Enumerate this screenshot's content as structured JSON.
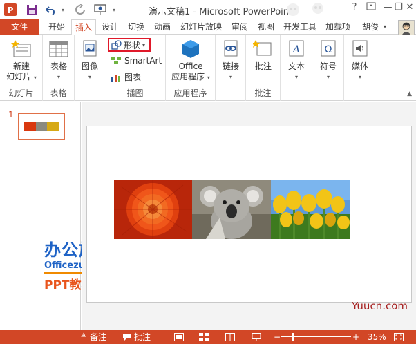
{
  "window": {
    "title": "演示文稿1 - Microsoft PowerPoint",
    "controls": {
      "help": "?",
      "minimize": "—",
      "restore": "❐",
      "close": "✕"
    }
  },
  "quick_access": [
    "save-icon",
    "undo-icon",
    "redo-icon",
    "slideshow-icon"
  ],
  "tabs": {
    "file": "文件",
    "items": [
      "开始",
      "插入",
      "设计",
      "切换",
      "动画",
      "幻灯片放映",
      "审阅",
      "视图",
      "开发工具",
      "加载项",
      "胡俊"
    ],
    "active": "插入"
  },
  "ribbon": {
    "slides_group": {
      "label": "幻灯片",
      "new_slide_line1": "新建",
      "new_slide_line2": "幻灯片"
    },
    "table_group": {
      "label": "表格",
      "table": "表格"
    },
    "images_group": {
      "image": "图像"
    },
    "illustrations_group": {
      "label": "插图",
      "shapes": "形状",
      "smartart": "SmartArt",
      "chart": "图表"
    },
    "apps_group": {
      "label": "应用程序",
      "office_line1": "Office",
      "office_line2": "应用程序"
    },
    "links_group": {
      "link": "链接"
    },
    "comments_group": {
      "label": "批注",
      "comment": "批注"
    },
    "text_group": {
      "text": "文本"
    },
    "symbols_group": {
      "symbol": "符号"
    },
    "media_group": {
      "media": "媒体"
    },
    "accent_color": "#d24726",
    "highlight_color": "#e0192a"
  },
  "thumbnails": {
    "slide_number": "1"
  },
  "watermark": {
    "brand": "办公族",
    "site": "Officezu.com",
    "caption": "PPT教程",
    "corner": "Yuucn.com"
  },
  "status": {
    "notes": "备注",
    "comments": "批注",
    "zoom": "35%",
    "zoom_minus": "−",
    "zoom_plus": "+"
  }
}
